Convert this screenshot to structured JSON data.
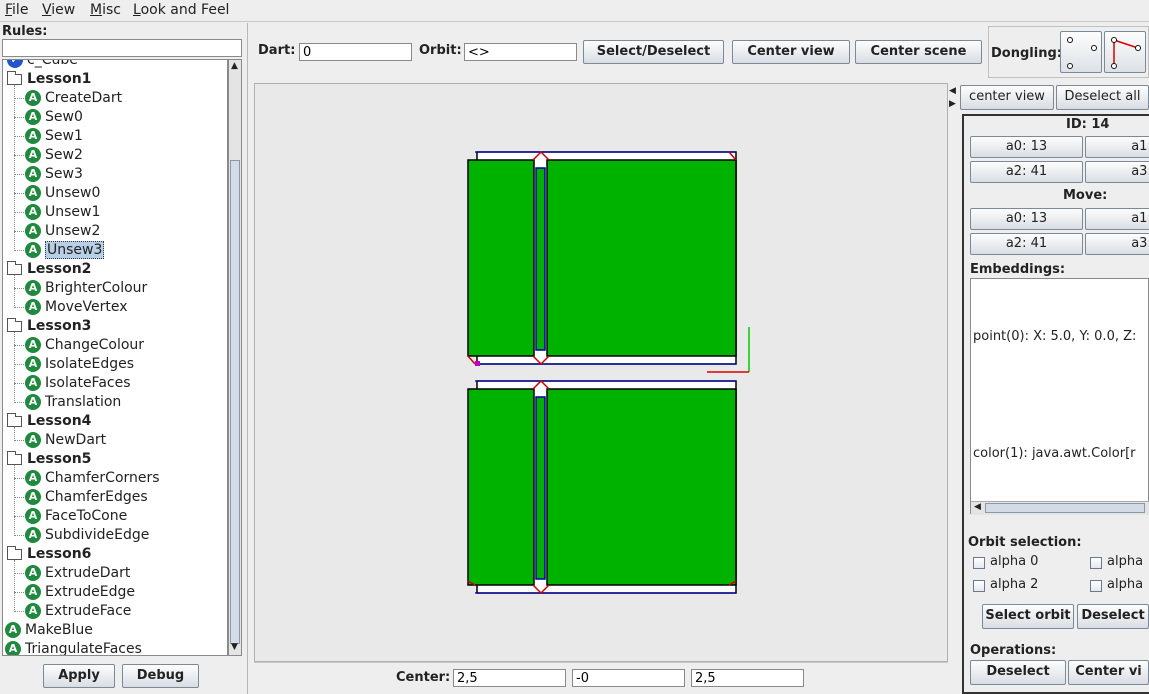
{
  "menu": {
    "items": [
      {
        "label": "File",
        "mnemonic": "F",
        "rest": "ile"
      },
      {
        "label": "View",
        "mnemonic": "V",
        "rest": "iew"
      },
      {
        "label": "Misc",
        "mnemonic": "M",
        "rest": "isc"
      },
      {
        "label": "Look and Feel",
        "mnemonic": "L",
        "rest": "ook and Feel"
      }
    ]
  },
  "rules": {
    "label": "Rules:",
    "search_value": "",
    "partial_top_item": "c_Cube",
    "tree": [
      {
        "type": "lesson",
        "label": "Lesson1",
        "children": [
          "CreateDart",
          "Sew0",
          "Sew1",
          "Sew2",
          "Sew3",
          "Unsew0",
          "Unsew1",
          "Unsew2",
          "Unsew3"
        ]
      },
      {
        "type": "lesson",
        "label": "Lesson2",
        "children": [
          "BrighterColour",
          "MoveVertex"
        ]
      },
      {
        "type": "lesson",
        "label": "Lesson3",
        "children": [
          "ChangeColour",
          "IsolateEdges",
          "IsolateFaces",
          "Translation"
        ]
      },
      {
        "type": "lesson",
        "label": "Lesson4",
        "children": [
          "NewDart"
        ]
      },
      {
        "type": "lesson",
        "label": "Lesson5",
        "children": [
          "ChamferCorners",
          "ChamferEdges",
          "FaceToCone",
          "SubdivideEdge"
        ]
      },
      {
        "type": "lesson",
        "label": "Lesson6",
        "children": [
          "ExtrudeDart",
          "ExtrudeEdge",
          "ExtrudeFace"
        ]
      }
    ],
    "root_rules": [
      "MakeBlue",
      "TriangulateFaces"
    ],
    "selected": "Unsew3",
    "apply_label": "Apply",
    "debug_label": "Debug"
  },
  "toolbar": {
    "dart_label": "Dart:",
    "dart_value": "0",
    "orbit_label": "Orbit:",
    "orbit_value": "<>",
    "select_label": "Select/Deselect",
    "center_view_label": "Center view",
    "center_scene_label": "Center scene",
    "dongling_label": "Dongling:"
  },
  "center_bar": {
    "label": "Center:",
    "x": "2,5",
    "y": "-0",
    "z": "2,5"
  },
  "right": {
    "center_view_label": "center view",
    "deselect_all_label": "Deselect all",
    "id_label": "ID: 14",
    "alpha_buttons": [
      "a0: 13",
      "a1: ",
      "a2: 41",
      "a3: "
    ],
    "move_label": "Move:",
    "move_buttons": [
      "a0: 13",
      "a1: ",
      "a2: 41",
      "a3: "
    ],
    "embeddings_label": "Embeddings:",
    "embeddings": [
      "point(0): X: 5.0, Y: 0.0, Z:",
      "color(1): java.awt.Color[r"
    ],
    "orbit_selection_label": "Orbit selection:",
    "orbit_checks": [
      "alpha 0",
      "alpha",
      "alpha 2",
      "alpha"
    ],
    "select_orbit_label": "Select orbit",
    "deselect_label": "Deselect",
    "operations_label": "Operations:",
    "op_deselect_label": "Deselect",
    "op_center_label": "Center vi"
  },
  "colors": {
    "face_green": "#00b200",
    "edge_blue": "#0000aa",
    "vertex_red": "#d00000",
    "axis_green": "#00cc00",
    "axis_red": "#dd0000"
  }
}
